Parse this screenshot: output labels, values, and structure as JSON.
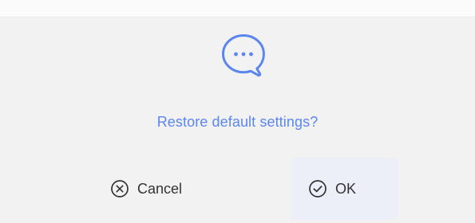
{
  "dialog": {
    "message": "Restore default settings?",
    "icon": "chat-bubble-ellipsis-icon",
    "accent_color": "#5b86f0"
  },
  "buttons": {
    "cancel": {
      "label": "Cancel",
      "icon": "circle-x-icon"
    },
    "ok": {
      "label": "OK",
      "icon": "circle-check-icon"
    }
  }
}
